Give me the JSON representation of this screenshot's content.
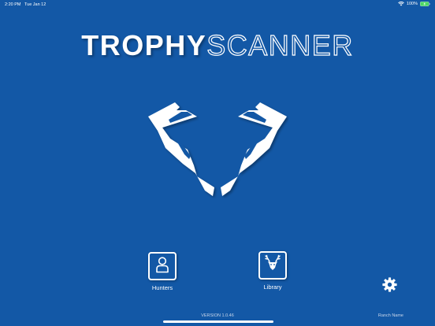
{
  "status_bar": {
    "time": "2:20 PM",
    "date": "Tue Jan 12",
    "battery_percent": "100%",
    "wifi_icon": "wifi-icon",
    "battery_icon": "battery-charging-icon"
  },
  "title": {
    "bold_part": "TROPHY",
    "outline_part": "SCANNER"
  },
  "logo": {
    "icon": "horns-logo-icon"
  },
  "nav": {
    "hunters": {
      "label": "Hunters",
      "icon": "person-icon"
    },
    "library": {
      "label": "Library",
      "icon": "deer-head-icon"
    }
  },
  "settings": {
    "icon": "gear-icon"
  },
  "footer": {
    "version": "VERSION 1.0.46",
    "ranch_name": "Ranch Name"
  },
  "colors": {
    "background": "#1358a6",
    "foreground": "#ffffff"
  }
}
